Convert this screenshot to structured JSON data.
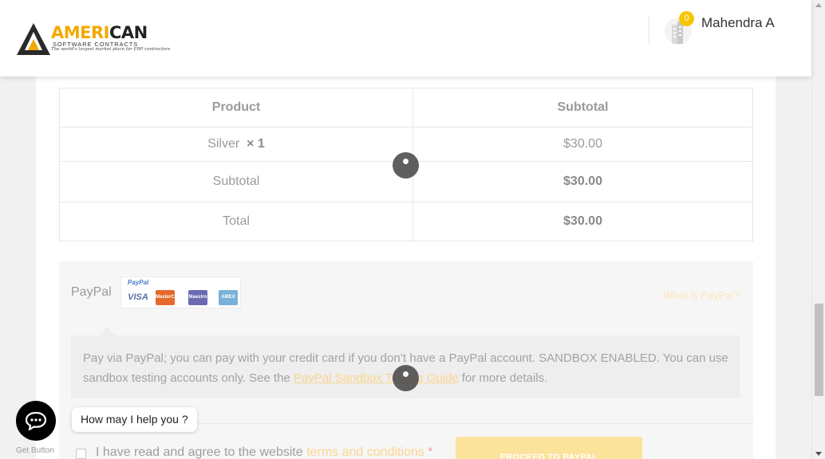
{
  "header": {
    "logo": {
      "part1": "AMERI",
      "part2": "CAN",
      "subtitle": "SOFTWARE CONTRACTS",
      "tagline": "The world's largest market place for ERP contractors"
    },
    "cart_count": "0",
    "user_name": "Mahendra A"
  },
  "order_table": {
    "headers": [
      "Product",
      "Subtotal"
    ],
    "item": {
      "name": "Silver",
      "qty": "× 1",
      "price": "$30.00"
    },
    "subtotal": {
      "label": "Subtotal",
      "value": "$30.00"
    },
    "total": {
      "label": "Total",
      "value": "$30.00"
    }
  },
  "payment": {
    "method_label": "PayPal",
    "card_logos": {
      "paypal": "PayPal",
      "visa": "VISA",
      "mastercard": "MasterCard",
      "maestro": "Maestro",
      "amex": "AMEX"
    },
    "what_is_link": "What is PayPal?",
    "notice_text_1": "Pay via PayPal; you can pay with your credit card if you don’t have a PayPal account. SANDBOX ENABLED. You can use sandbox testing accounts only. See the ",
    "notice_link": "PayPal Sandbox Testing Guide",
    "notice_text_2": " for more details."
  },
  "terms": {
    "text": "I have read and agree to the website ",
    "link": "terms and conditions",
    "required": "*"
  },
  "proceed_button": "PROCEED TO PAYPAL",
  "chat": {
    "bubble": "How may I help you ?",
    "get_button": "Get Button"
  },
  "colors": {
    "accent": "#f7c600",
    "link": "#f2a900"
  }
}
